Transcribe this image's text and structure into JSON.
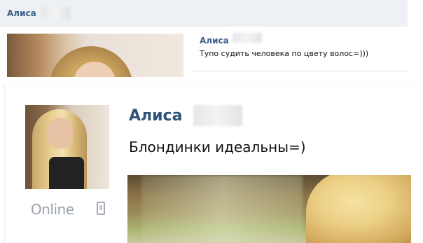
{
  "header": {
    "name": "Алиса"
  },
  "post_small": {
    "author": "Алиса",
    "text": "Тупо судить человека по цвету волос=)))"
  },
  "post_large": {
    "author": "Алиса",
    "text": "Блондинки идеальны=)",
    "status": "Online",
    "status_icon": "mobile-phone-icon"
  },
  "colors": {
    "name_link": "#2f5478",
    "header_bg": "#edf0f4",
    "online_gray": "#9aa2ad"
  }
}
